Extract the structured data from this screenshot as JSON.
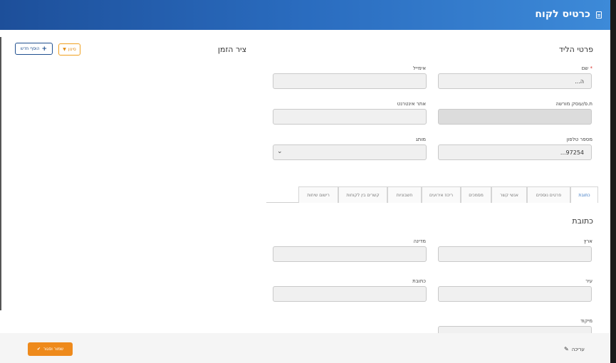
{
  "header": {
    "title": "כרטיס לקוח",
    "icon": "document-icon"
  },
  "lead_details": {
    "section_title": "פרטי הליד",
    "name_label": "שם",
    "name_required_mark": "*",
    "name_value": "ה...",
    "email_label": "אימייל",
    "email_value": "",
    "company_id_label": "ת.פ/עוסק מורשה",
    "company_id_value": "",
    "website_label": "אתר אינטרנט",
    "website_value": "",
    "phone_label": "מספר טלפון",
    "phone_value": "97254...",
    "gender_label": "מותג",
    "gender_value": ""
  },
  "timeline": {
    "title": "ציר הזמן",
    "add_button": "הוסף חדש",
    "filter_button": "סינון"
  },
  "tabs": [
    {
      "label": "כתובת",
      "active": true
    },
    {
      "label": "פרטים נוספים",
      "active": false
    },
    {
      "label": "אנשי קשר",
      "active": false
    },
    {
      "label": "מסמכים",
      "active": false
    },
    {
      "label": "ריכוז אירועים",
      "active": false
    },
    {
      "label": "חשבוניות",
      "active": false
    },
    {
      "label": "קשרים בין לקוחות",
      "active": false
    },
    {
      "label": "רישום שיחות",
      "active": false
    }
  ],
  "address": {
    "section_title": "כתובת",
    "country_label": "ארץ",
    "state_label": "מדינה",
    "city_label": "עיר",
    "street_label": "כתובת",
    "zip_label": "מיקוד"
  },
  "footer": {
    "save_button": "שמור וסגור",
    "edit_label": "עריכה"
  },
  "colors": {
    "header_start": "#1d4f9a",
    "header_end": "#3d8ad8",
    "accent_orange": "#ee8a1c",
    "active_tab": "#2a6cbf"
  }
}
